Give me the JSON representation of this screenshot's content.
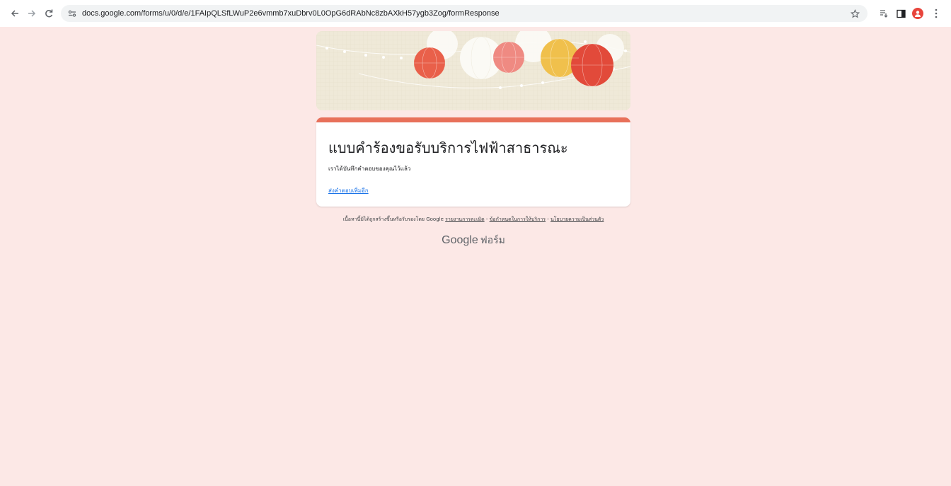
{
  "browser": {
    "url": "docs.google.com/forms/u/0/d/e/1FAIpQLSfLWuP2e6vmmb7xuDbrv0L0OpG6dRAbNc8zbAXkH57ygb3Zog/formResponse",
    "icons": [
      "back-arrow-icon",
      "forward-arrow-icon",
      "reload-icon",
      "site-info-icon",
      "star-icon",
      "extensions-icon",
      "side-panel-icon",
      "profile-avatar-icon",
      "more-menu-icon"
    ]
  },
  "form": {
    "title": "แบบคำร้องขอรับบริการไฟฟ้าสาธารณะ",
    "confirmation": "เราได้บันทึกคำตอบของคุณไว้แล้ว",
    "submit_another": "ส่งคำตอบเพิ่มอีก",
    "accent_color": "#e8705a"
  },
  "footer": {
    "disclaimer_prefix": "เนื้อหานี้มิได้ถูกสร้างขึ้นหรือรับรองโดย Google",
    "report_abuse": "รายงานการละเมิด",
    "terms": "ข้อกำหนดในการให้บริการ",
    "privacy": "นโยบายความเป็นส่วนตัว",
    "separator": " - ",
    "brand_google": "Google",
    "brand_forms": "ฟอร์ม"
  },
  "colors": {
    "page_background": "#fce8e6",
    "link": "#1a73e8"
  }
}
